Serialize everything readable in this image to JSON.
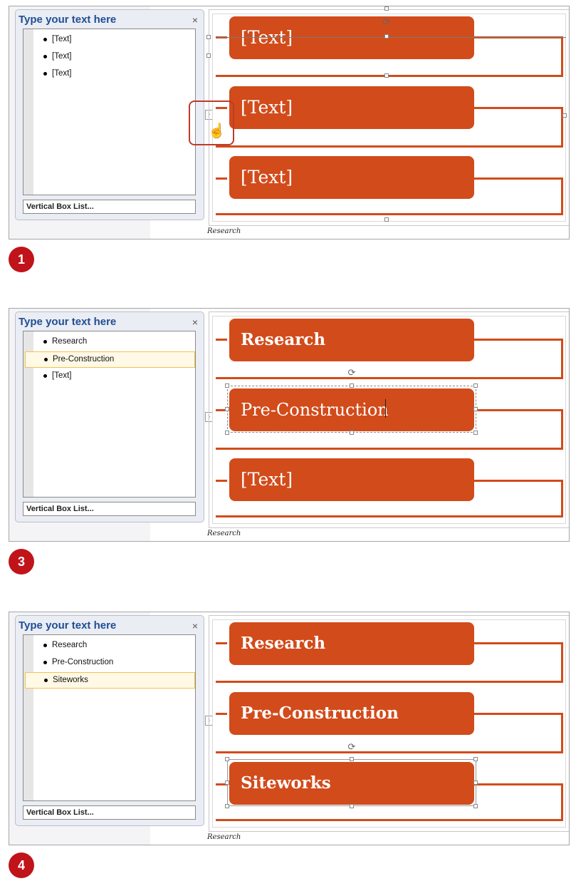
{
  "text_pane_title": "Type your text here",
  "close_glyph": "×",
  "footer_label": "Vertical Box List...",
  "expander_glyph": "›",
  "caption": "Research",
  "accent_color": "#d24b1b",
  "steps": [
    {
      "number": "1",
      "items": [
        "[Text]",
        "[Text]",
        "[Text]"
      ],
      "boxes": [
        "[Text]",
        "[Text]",
        "[Text]"
      ]
    },
    {
      "number": "3",
      "items": [
        "Research",
        "Pre-Construction",
        "[Text]"
      ],
      "boxes": [
        "Research",
        "Pre-Construction",
        "[Text]"
      ]
    },
    {
      "number": "4",
      "items": [
        "Research",
        "Pre-Construction",
        "Siteworks"
      ],
      "boxes": [
        "Research",
        "Pre-Construction",
        "Siteworks"
      ]
    }
  ]
}
